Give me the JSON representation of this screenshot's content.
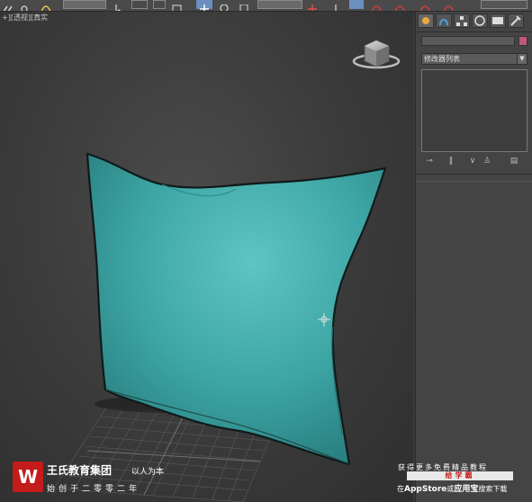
{
  "viewport": {
    "label": "+][透视][真实",
    "object": "cushion"
  },
  "toolbar": {
    "items": [
      "link-icon",
      "unlink-icon",
      "bind-icon",
      "selection-filter",
      "select-icon",
      "select-region-icon",
      "window-crossing-icon",
      "select-move-icon",
      "rotate-icon",
      "scale-icon",
      "reference-coordinate-dropdown",
      "mirror-icon",
      "align-icon",
      "layers-icon",
      "render-icon"
    ]
  },
  "command_panel": {
    "tabs": [
      "create-tab",
      "modify-tab",
      "hierarchy-tab",
      "motion-tab",
      "display-tab",
      "utilities-tab"
    ],
    "object_name": "",
    "object_color": "#c0577a",
    "modifier_list_label": "修改器列表",
    "stack_buttons": [
      "pin-stack-icon",
      "show-end-result-icon",
      "make-unique-icon",
      "remove-modifier-icon",
      "configure-modifier-sets-icon"
    ]
  },
  "watermark": {
    "brand_name": "王氏教育集团",
    "motto": "以人为本",
    "founded": "始创于二零零二年",
    "promo_line1": "获得更多免费精品教程",
    "promo_app": "给学霸",
    "promo_line3_pre": "在",
    "promo_line3_store": "AppStore",
    "promo_line3_mid": "或",
    "promo_line3_app": "应用宝",
    "promo_line3_post": "搜索下载",
    "logo_letter": "W"
  },
  "colors": {
    "object": "#3ea7a6",
    "viewport_bg": "#3a3a3a",
    "brand_red": "#c41b1b"
  }
}
